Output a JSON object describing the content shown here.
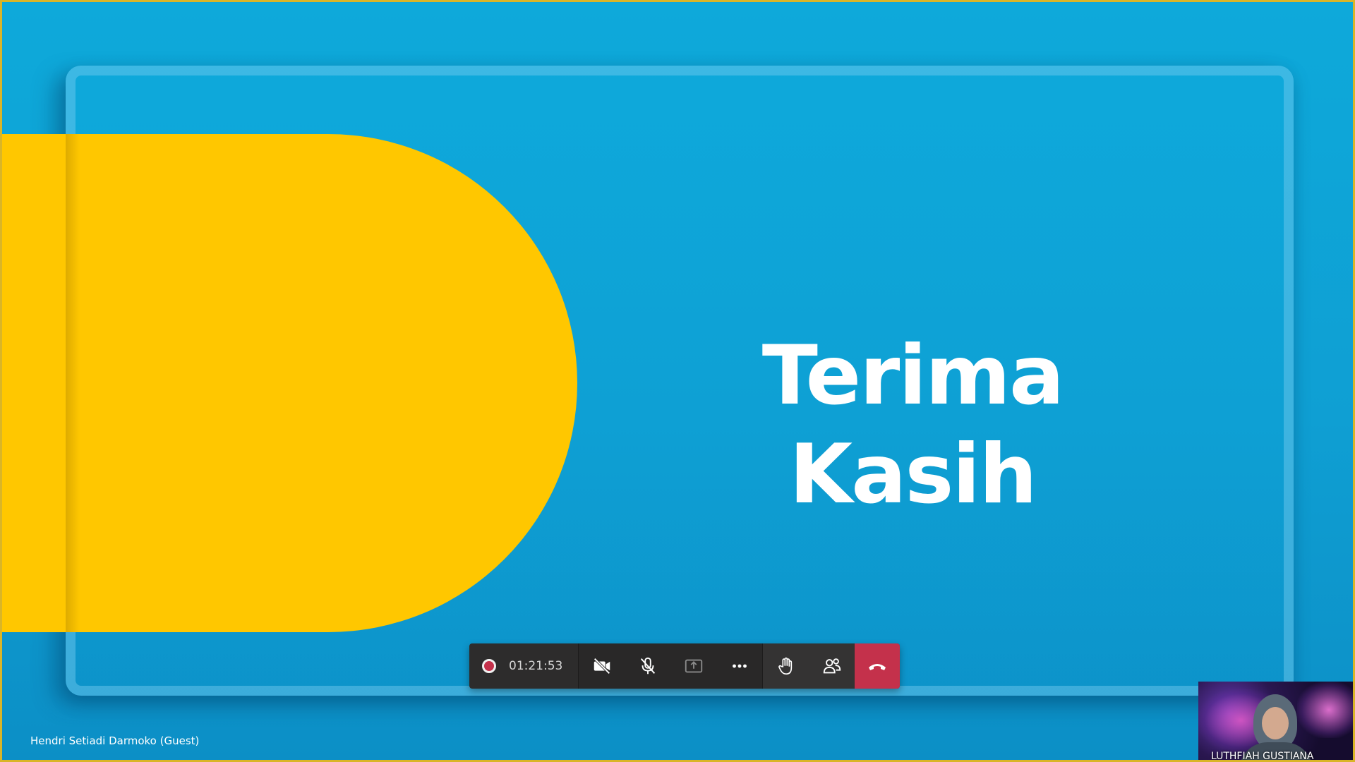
{
  "slide": {
    "title": "Terima Kasih"
  },
  "toolbar": {
    "recording_timer": "01:21:53",
    "buttons": [
      {
        "name": "camera-off-button",
        "icon": "video-off-icon"
      },
      {
        "name": "mic-muted-button",
        "icon": "mic-off-icon"
      },
      {
        "name": "share-screen-button",
        "icon": "share-tray-icon"
      },
      {
        "name": "more-actions-button",
        "icon": "ellipsis-icon"
      },
      {
        "name": "raise-hand-button",
        "icon": "hand-icon"
      },
      {
        "name": "participants-button",
        "icon": "people-icon"
      },
      {
        "name": "hang-up-button",
        "icon": "phone-hangup-icon"
      }
    ]
  },
  "participants": {
    "presenter_label": "Hendri Setiadi Darmoko (Guest)",
    "self_video_label": "LUTHFIAH GUSTIANA"
  },
  "colors": {
    "slide_background": "#0ea9da",
    "slide_accent": "#ffc700",
    "toolbar_bg": "#292828",
    "hangup_red": "#c4314b",
    "frame_border": "#d9b528"
  }
}
